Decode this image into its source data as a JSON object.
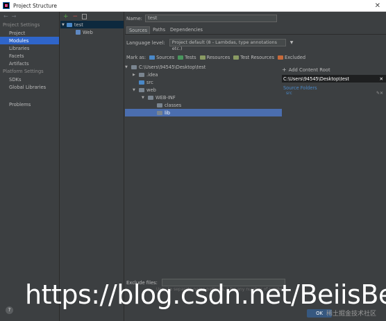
{
  "window": {
    "title": "Project Structure"
  },
  "nav": {
    "project_settings_header": "Project Settings",
    "project_settings": [
      "Project",
      "Modules",
      "Libraries",
      "Facets",
      "Artifacts"
    ],
    "platform_settings_header": "Platform Settings",
    "platform_settings": [
      "SDKs",
      "Global Libraries"
    ],
    "problems": "Problems",
    "selected": "Modules",
    "help_label": "?"
  },
  "modules": {
    "toolbar": {
      "add": "+",
      "remove": "−"
    },
    "tree": [
      {
        "label": "test",
        "level": 0,
        "selected": true
      },
      {
        "label": "Web",
        "level": 1,
        "selected": false
      }
    ]
  },
  "main": {
    "name_label": "Name:",
    "name_value": "test",
    "tabs": [
      "Sources",
      "Paths",
      "Dependencies"
    ],
    "active_tab": "Sources",
    "language_level_label": "Language level:",
    "language_level_value": "Project default (8 - Lambdas, type annotations etc.)",
    "mark_as_label": "Mark as:",
    "mark_as": [
      "Sources",
      "Tests",
      "Resources",
      "Test Resources",
      "Excluded"
    ],
    "content_tree": [
      {
        "label": "C:\\Users\\94545\\Desktop\\test",
        "level": 0,
        "expanded": true,
        "selected": false,
        "icon": "folder-dark"
      },
      {
        "label": ".idea",
        "level": 1,
        "expanded": false,
        "selected": false,
        "icon": "folder-dark"
      },
      {
        "label": "src",
        "level": 1,
        "expanded": null,
        "selected": false,
        "icon": "folder-blue"
      },
      {
        "label": "web",
        "level": 1,
        "expanded": true,
        "selected": false,
        "icon": "folder-dark"
      },
      {
        "label": "WEB-INF",
        "level": 2,
        "expanded": true,
        "selected": false,
        "icon": "folder-dark"
      },
      {
        "label": "classes",
        "level": 3,
        "expanded": null,
        "selected": false,
        "icon": "folder-dark"
      },
      {
        "label": "lib",
        "level": 3,
        "expanded": null,
        "selected": true,
        "icon": "folder-dark"
      }
    ],
    "add_content_root": "Add Content Root",
    "content_root_path": "C:\\Users\\94545\\Desktop\\test",
    "source_folders_header": "Source Folders",
    "source_folders": [
      "src"
    ],
    "exclude_files_label": "Exclude files:",
    "exclude_hint": "Use ; to separate name patterns, * for any number of symbols"
  },
  "buttons": {
    "ok": "OK"
  },
  "watermark": {
    "url": "https://blog.csdn.net/BeiisBei",
    "cn": "稀土掘金技术社区"
  }
}
